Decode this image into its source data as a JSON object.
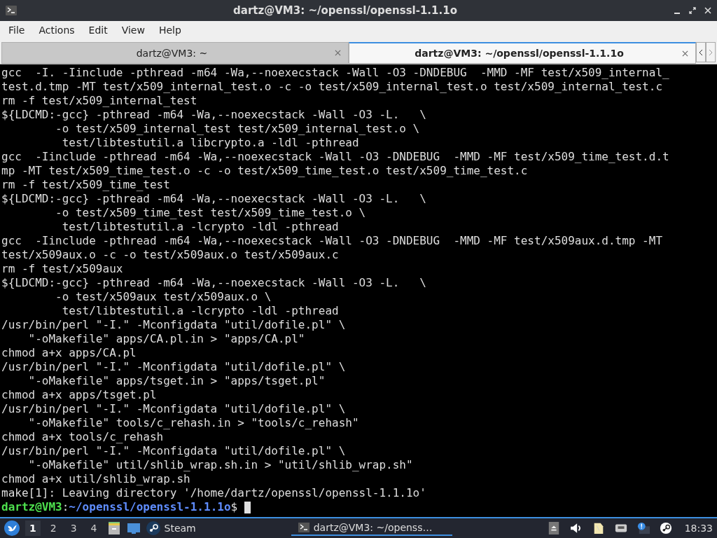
{
  "window": {
    "title": "dartz@VM3: ~/openssl/openssl-1.1.1o"
  },
  "menu": [
    "File",
    "Actions",
    "Edit",
    "View",
    "Help"
  ],
  "tabs": [
    {
      "label": "dartz@VM3: ~",
      "selected": false
    },
    {
      "label": "dartz@VM3: ~/openssl/openssl-1.1.1o",
      "selected": true
    }
  ],
  "terminal": {
    "lines": [
      "gcc  -I. -Iinclude -pthread -m64 -Wa,--noexecstack -Wall -O3 -DNDEBUG  -MMD -MF test/x509_internal_",
      "test.d.tmp -MT test/x509_internal_test.o -c -o test/x509_internal_test.o test/x509_internal_test.c",
      "rm -f test/x509_internal_test",
      "${LDCMD:-gcc} -pthread -m64 -Wa,--noexecstack -Wall -O3 -L.   \\",
      "        -o test/x509_internal_test test/x509_internal_test.o \\",
      "         test/libtestutil.a libcrypto.a -ldl -pthread",
      "gcc  -Iinclude -pthread -m64 -Wa,--noexecstack -Wall -O3 -DNDEBUG  -MMD -MF test/x509_time_test.d.t",
      "mp -MT test/x509_time_test.o -c -o test/x509_time_test.o test/x509_time_test.c",
      "rm -f test/x509_time_test",
      "${LDCMD:-gcc} -pthread -m64 -Wa,--noexecstack -Wall -O3 -L.   \\",
      "        -o test/x509_time_test test/x509_time_test.o \\",
      "         test/libtestutil.a -lcrypto -ldl -pthread",
      "gcc  -Iinclude -pthread -m64 -Wa,--noexecstack -Wall -O3 -DNDEBUG  -MMD -MF test/x509aux.d.tmp -MT",
      "test/x509aux.o -c -o test/x509aux.o test/x509aux.c",
      "rm -f test/x509aux",
      "${LDCMD:-gcc} -pthread -m64 -Wa,--noexecstack -Wall -O3 -L.   \\",
      "        -o test/x509aux test/x509aux.o \\",
      "         test/libtestutil.a -lcrypto -ldl -pthread",
      "/usr/bin/perl \"-I.\" -Mconfigdata \"util/dofile.pl\" \\",
      "    \"-oMakefile\" apps/CA.pl.in > \"apps/CA.pl\"",
      "chmod a+x apps/CA.pl",
      "/usr/bin/perl \"-I.\" -Mconfigdata \"util/dofile.pl\" \\",
      "    \"-oMakefile\" apps/tsget.in > \"apps/tsget.pl\"",
      "chmod a+x apps/tsget.pl",
      "/usr/bin/perl \"-I.\" -Mconfigdata \"util/dofile.pl\" \\",
      "    \"-oMakefile\" tools/c_rehash.in > \"tools/c_rehash\"",
      "chmod a+x tools/c_rehash",
      "/usr/bin/perl \"-I.\" -Mconfigdata \"util/dofile.pl\" \\",
      "    \"-oMakefile\" util/shlib_wrap.sh.in > \"util/shlib_wrap.sh\"",
      "chmod a+x util/shlib_wrap.sh",
      "make[1]: Leaving directory '/home/dartz/openssl/openssl-1.1.1o'"
    ],
    "prompt": {
      "user": "dartz@VM3",
      "separator": ":",
      "path": "~/openssl/openssl-1.1.1o",
      "symbol": "$"
    }
  },
  "taskbar": {
    "desktops": [
      {
        "label": "1",
        "selected": true
      },
      {
        "label": "2",
        "selected": false
      },
      {
        "label": "3",
        "selected": false
      },
      {
        "label": "4",
        "selected": false
      }
    ],
    "launchers": [
      {
        "kind": "files"
      },
      {
        "kind": "desktop"
      },
      {
        "kind": "steam",
        "label": "Steam"
      }
    ],
    "task": {
      "label": "dartz@VM3: ~/openss…",
      "selected": true
    },
    "tray": [
      {
        "kind": "eject"
      },
      {
        "kind": "volume"
      },
      {
        "kind": "clipboard"
      },
      {
        "kind": "network"
      },
      {
        "kind": "notice"
      },
      {
        "kind": "steam"
      }
    ],
    "clock": "18:33"
  }
}
